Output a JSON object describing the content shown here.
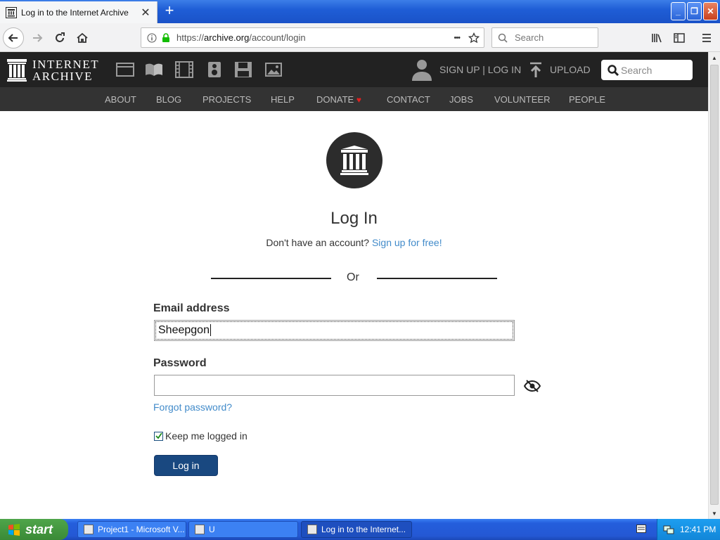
{
  "browser": {
    "tab_title": "Log in to the Internet Archive",
    "tab_close": "✕",
    "new_tab": "+",
    "url": "https://archive.org/account/login",
    "url_scheme": "https://",
    "url_host": "archive.org",
    "url_path": "/account/login",
    "page_actions": "•••",
    "search_placeholder": "Search"
  },
  "site": {
    "logo_line1": "INTERNET",
    "logo_line2": "ARCHIVE",
    "media_icons": [
      "web-icon",
      "texts-icon",
      "video-icon",
      "audio-icon",
      "software-icon",
      "images-icon"
    ],
    "signup_login": "SIGN UP | LOG IN",
    "upload": "UPLOAD",
    "search_placeholder": "Search",
    "nav": [
      "ABOUT",
      "BLOG",
      "PROJECTS",
      "HELP",
      "DONATE",
      "CONTACT",
      "JOBS",
      "VOLUNTEER",
      "PEOPLE"
    ],
    "donate_heart_color": "#e02020"
  },
  "login": {
    "title": "Log In",
    "no_account": "Don't have an account?",
    "signup_link": "Sign up for free!",
    "or": "Or",
    "email_label": "Email address",
    "email_value": "Sheepgon",
    "password_label": "Password",
    "password_value": "",
    "forgot": "Forgot password?",
    "remember_label": "Keep me logged in",
    "remember_checked": true,
    "submit": "Log in"
  },
  "taskbar": {
    "start": "start",
    "items": [
      "Project1 - Microsoft V...",
      "U",
      "Log in to the Internet..."
    ],
    "active_item": 2,
    "clock": "12:41 PM"
  },
  "colors": {
    "ia_header": "#222222",
    "ia_subnav": "#333333",
    "link": "#428bca",
    "submit_button": "#194880"
  }
}
